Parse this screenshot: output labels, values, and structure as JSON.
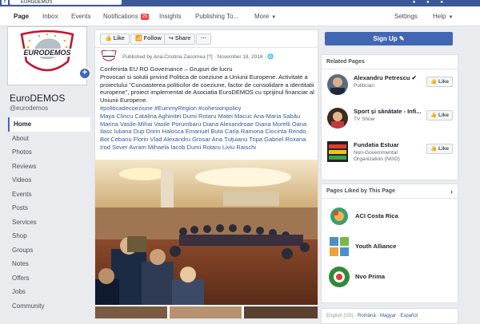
{
  "topbar": {
    "brand": "f",
    "search_value": "EURODEMOS",
    "right_icons": "● ● ●"
  },
  "tabs": {
    "page": "Page",
    "inbox": "Inbox",
    "events": "Events",
    "notifications": "Notifications",
    "notifications_count": "25",
    "insights": "Insights",
    "publishing": "Publishing To...",
    "more": "More",
    "settings": "Settings",
    "help": "Help"
  },
  "profile": {
    "name": "EuroDEMOS",
    "handle": "@eurodemos",
    "logo_text": "EURODEMOS"
  },
  "nav": [
    "Home",
    "About",
    "Photos",
    "Reviews",
    "Videos",
    "Events",
    "Posts",
    "Services",
    "Shop",
    "Groups",
    "Notes",
    "Offers",
    "Jobs",
    "Community"
  ],
  "post": {
    "like": "Like",
    "follow": "Follow",
    "share": "Share",
    "more": "···",
    "published_by": "Published by Ana-Cristina Zacornea [?] · November 18, 2018 ·",
    "text_line1": "Conferinta EU RO Governance – Grupuri de lucru",
    "text_body": "Provocari si solutii privind Politica de coeziune a Uniunii Europene. Activitate a proiectului \"Cunoasterea politicilor de coeziune, factor de consolidare a identitatii europene\", proiect implementat de Asociatia EuroDEMOS cu sprijinul financiar al Uniunii Europene.",
    "hashtags": "#politicadecoeziune #EuinmyRegion #cohesionpolicy",
    "tags": "Maya Clincu Catalina Aghinitei Dumi Rotaru Matei Macuc Ana-Maria Sabău Marina Vasile-Mihai Vasile Porumbaru Diana Alexandroae Diana Morelli Oana Ilasc Iuliana Dup Dorin Halosca Emanuel Buta Carla Ramona Ciocinta Rendo Bot Cebanu Florin Vlad Alexandru Grosar Ana Țuțuianu Tripa Gabriel Roxana Irod Sever Avram Mihaela Iacob Dumi Rotaru Liviu Raischi"
  },
  "right": {
    "signup": "Sign Up ✎",
    "related_title": "Related Pages",
    "related": [
      {
        "name": "Alexandru Petrescu ✔",
        "sub": "Politician",
        "like": "👍 Like"
      },
      {
        "name": "Sport și sănătate - Infi...",
        "sub": "TV Show",
        "like": "👍 Like"
      },
      {
        "name": "Fundatia Estuar",
        "sub": "Non-Governmental Organization (NGO)",
        "like": "👍 Like"
      }
    ],
    "liked_title": "Pages Liked by This Page",
    "liked": [
      "ACI Costa Rica",
      "Youth Alliance",
      "Nvo Prima"
    ],
    "footer_lang": "English (US) ·",
    "footer_links": "Română · Magyar · Español"
  },
  "colors": {
    "brand": "#3b5998",
    "accent": "#4267b2",
    "link": "#365899"
  }
}
